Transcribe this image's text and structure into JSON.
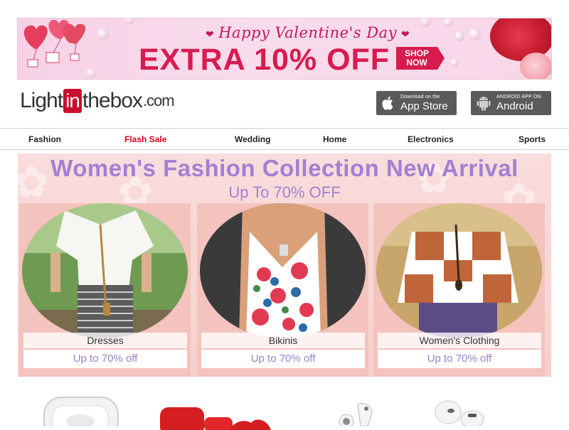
{
  "banner": {
    "heading": "Happy Valentine's Day",
    "offer": "EXTRA 10% OFF",
    "shop_line1": "SHOP",
    "shop_line2": "NOW",
    "accent_color": "#d81b4f"
  },
  "header": {
    "logo_light": "Light",
    "logo_in": "in",
    "logo_thebox": "thebox",
    "logo_com": ".com",
    "appstore_small": "Download on the",
    "appstore_big": "App Store",
    "android_small": "ANDROID APP ON",
    "android_big": "Android"
  },
  "nav": {
    "items": [
      "Fashion",
      "Flash Sale",
      "Wedding",
      "Home",
      "Electronics",
      "Sports"
    ],
    "highlight_color": "#e0001b"
  },
  "promo": {
    "title": "Women's Fashion Collection New Arrival",
    "subtitle": "Up To 70% OFF",
    "title_color": "#a180d4",
    "cards": [
      {
        "label": "Dresses",
        "deal": "Up to 70% off"
      },
      {
        "label": "Bikinis",
        "deal": "Up to 70% off"
      },
      {
        "label": "Women's Clothing",
        "deal": "Up to 70% off"
      }
    ]
  },
  "icons": [
    "heart-icon",
    "apple-icon",
    "android-icon",
    "shop-arrow-icon"
  ]
}
